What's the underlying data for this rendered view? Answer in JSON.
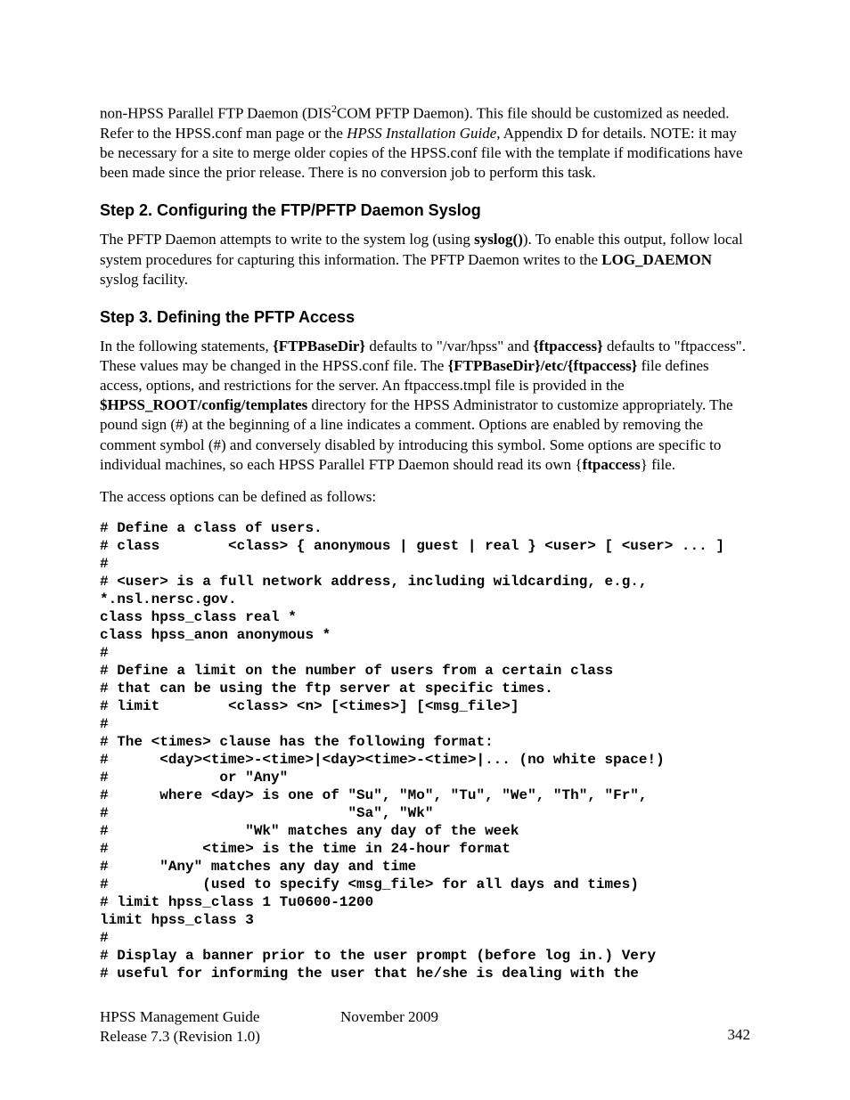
{
  "intro": {
    "p1a": "non-HPSS Parallel FTP Daemon (DIS",
    "p1sup": "2",
    "p1b": "COM PFTP Daemon).  This file should be customized as needed. Refer to the HPSS.conf man page or the ",
    "p1italic": "HPSS Installation Guide",
    "p1c": ", Appendix D for details.  NOTE: it may be necessary for a site to merge older copies of the HPSS.conf file with the template if modifications have been made since the prior release.  There is no conversion job to perform this task."
  },
  "step2": {
    "heading": "Step 2. Configuring the FTP/PFTP Daemon Syslog",
    "p1a": "The PFTP Daemon attempts to write to the system log (using ",
    "p1b": "syslog()",
    "p1c": "). To enable this output, follow local system procedures for capturing this information. The PFTP Daemon writes to the ",
    "p1d": "LOG_DAEMON",
    "p1e": " syslog facility."
  },
  "step3": {
    "heading": "Step 3. Defining the PFTP Access",
    "p1a": "In the following statements, ",
    "p1b": "{FTPBaseDir}",
    "p1c": " defaults to \"/var/hpss\" and ",
    "p1d": "{ftpaccess}",
    "p1e": " defaults to \"ftpaccess\".  These values may be changed in the HPSS.conf file.  The ",
    "p1f": "{FTPBaseDir}/etc/{ftpaccess}",
    "p1g": " file defines access, options, and restrictions for the server. An ftpaccess.tmpl file is provided in the ",
    "p1h": "$HPSS_ROOT/config/templates",
    "p1i": " directory for the HPSS Administrator to customize appropriately. The pound sign (#) at the beginning of a line indicates a comment. Options are enabled by removing the comment symbol (#) and conversely disabled by introducing this symbol. Some options are specific to individual machines, so each HPSS Parallel FTP Daemon should read its own {",
    "p1j": "ftpaccess",
    "p1k": "} file.",
    "p2": "The access options can be defined as follows:"
  },
  "code": "# Define a class of users.\n# class        <class> { anonymous | guest | real } <user> [ <user> ... ]\n#\n# <user> is a full network address, including wildcarding, e.g., *.nsl.nersc.gov.\nclass hpss_class real *\nclass hpss_anon anonymous *\n#\n# Define a limit on the number of users from a certain class\n# that can be using the ftp server at specific times.\n# limit        <class> <n> [<times>] [<msg_file>]\n#\n# The <times> clause has the following format:\n#      <day><time>-<time>|<day><time>-<time>|... (no white space!)\n#             or \"Any\"\n#      where <day> is one of \"Su\", \"Mo\", \"Tu\", \"We\", \"Th\", \"Fr\",\n#                            \"Sa\", \"Wk\"\n#                \"Wk\" matches any day of the week\n#           <time> is the time in 24-hour format\n#      \"Any\" matches any day and time\n#           (used to specify <msg_file> for all days and times)\n# limit hpss_class 1 Tu0600-1200\nlimit hpss_class 3\n#\n# Display a banner prior to the user prompt (before log in.) Very\n# useful for informing the user that he/she is dealing with the",
  "footer": {
    "guide": "HPSS Management Guide",
    "date": "November 2009",
    "release": "Release 7.3 (Revision 1.0)",
    "page": "342"
  }
}
